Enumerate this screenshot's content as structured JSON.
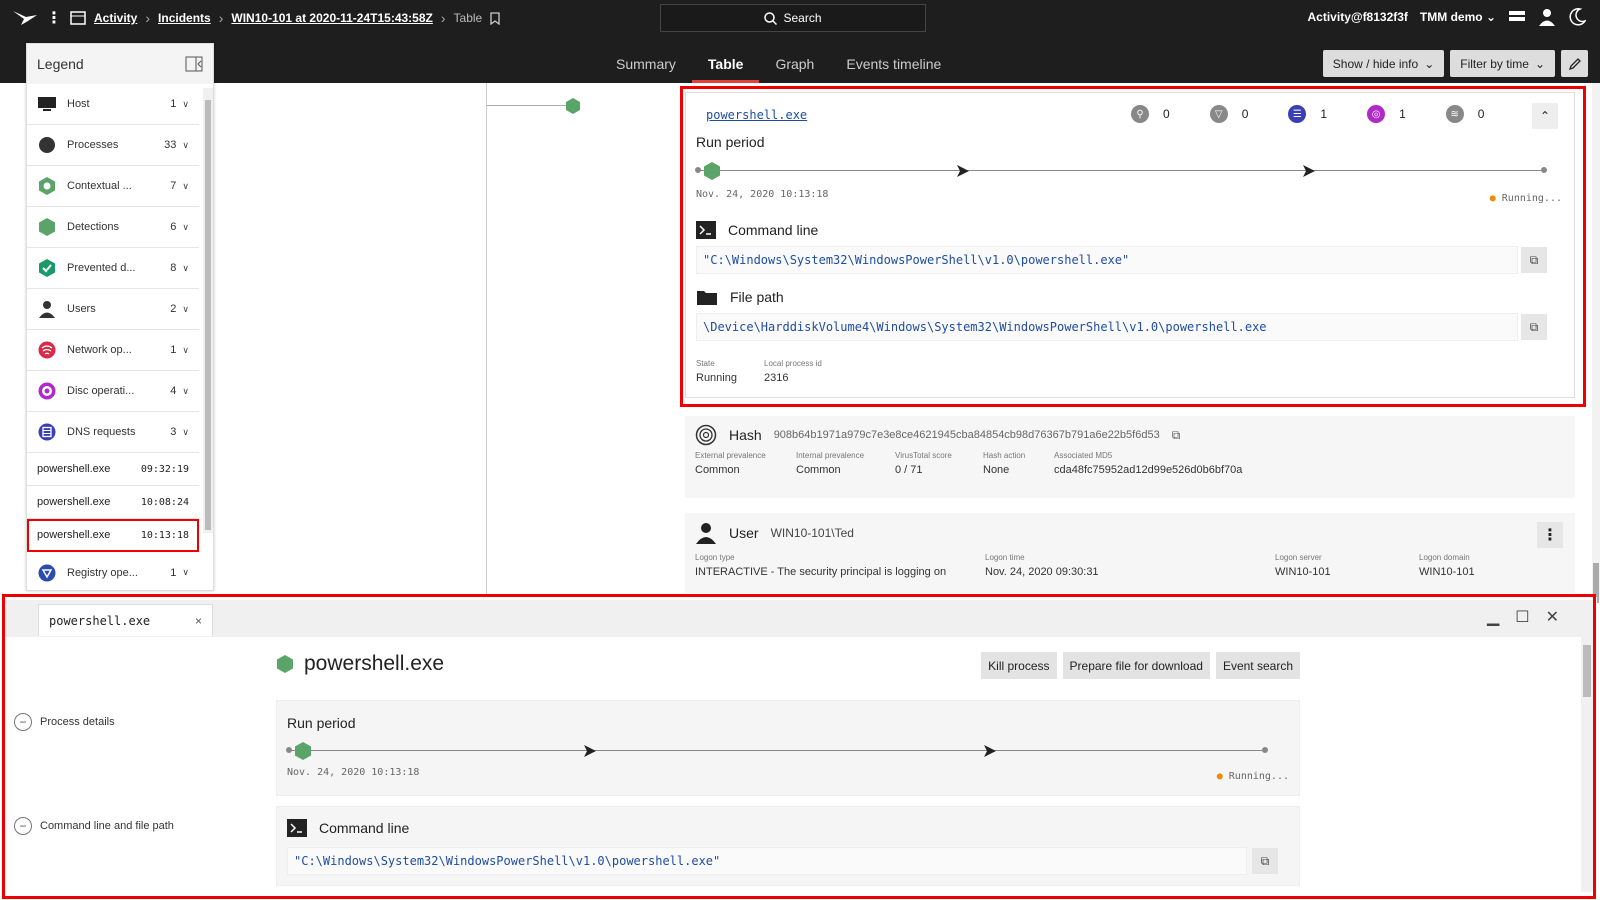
{
  "breadcrumb": {
    "items": [
      "Activity",
      "Incidents",
      "WIN10-101 at 2020-11-24T15:43:58Z"
    ],
    "current": "Table"
  },
  "search": {
    "label": "Search"
  },
  "account": {
    "user": "Activity@f8132f3f",
    "tenant": "TMM demo"
  },
  "tabs": [
    "Summary",
    "Table",
    "Graph",
    "Events timeline"
  ],
  "active_tab": "Table",
  "toolbar": {
    "show_hide_info": "Show / hide info",
    "filter_by_time": "Filter by time"
  },
  "legend": {
    "title": "Legend",
    "rows": [
      {
        "label": "Host",
        "count": "1",
        "icon": "monitor-icon"
      },
      {
        "label": "Processes",
        "count": "33",
        "icon": "process-dot-icon"
      },
      {
        "label": "Contextual ...",
        "count": "7",
        "icon": "contextual-hex-icon"
      },
      {
        "label": "Detections",
        "count": "6",
        "icon": "detection-hex-icon"
      },
      {
        "label": "Prevented d...",
        "count": "8",
        "icon": "shield-check-icon"
      },
      {
        "label": "Users",
        "count": "2",
        "icon": "user-icon"
      },
      {
        "label": "Network op...",
        "count": "1",
        "icon": "network-icon"
      },
      {
        "label": "Disc operati...",
        "count": "4",
        "icon": "disc-icon"
      },
      {
        "label": "DNS requests",
        "count": "3",
        "icon": "dns-icon"
      }
    ],
    "processes": [
      {
        "name": "powershell.exe",
        "time": "09:32:19"
      },
      {
        "name": "powershell.exe",
        "time": "10:08:24"
      },
      {
        "name": "powershell.exe",
        "time": "10:13:18"
      }
    ],
    "registry": {
      "label": "Registry ope...",
      "count": "1"
    }
  },
  "card": {
    "process_name": "powershell.exe",
    "icon_counts": [
      "0",
      "0",
      "1",
      "1",
      "0"
    ],
    "run_period_label": "Run period",
    "start_time": "Nov. 24, 2020 10:13:18",
    "running_label": "Running...",
    "command_line_label": "Command line",
    "command_line": "\"C:\\Windows\\System32\\WindowsPowerShell\\v1.0\\powershell.exe\"",
    "file_path_label": "File path",
    "file_path": "\\Device\\HarddiskVolume4\\Windows\\System32\\WindowsPowerShell\\v1.0\\powershell.exe",
    "state_label": "State",
    "state": "Running",
    "pid_label": "Local process id",
    "pid": "2316"
  },
  "hash": {
    "label": "Hash",
    "value": "908b64b1971a979c7e3e8ce4621945cba84854cb98d76367b791a6e22b5f6d53",
    "fields": [
      {
        "label": "External prevalence",
        "value": "Common"
      },
      {
        "label": "Internal prevalence",
        "value": "Common"
      },
      {
        "label": "VirusTotal score",
        "value": "0 / 71"
      },
      {
        "label": "Hash action",
        "value": "None"
      },
      {
        "label": "Associated MD5",
        "value": "cda48fc75952ad12d99e526d0b6bf70a"
      }
    ]
  },
  "user": {
    "label": "User",
    "value": "WIN10-101\\Ted",
    "fields": [
      {
        "label": "Logon type",
        "value": "INTERACTIVE - The security principal is logging on"
      },
      {
        "label": "Logon time",
        "value": "Nov. 24, 2020 09:30:31"
      },
      {
        "label": "Logon server",
        "value": "WIN10-101"
      },
      {
        "label": "Logon domain",
        "value": "WIN10-101"
      }
    ]
  },
  "panel": {
    "tab": "powershell.exe",
    "title": "powershell.exe",
    "buttons": [
      "Kill process",
      "Prepare file for download",
      "Event search"
    ],
    "side": [
      "Process details",
      "Command line and file path"
    ],
    "run_period_label": "Run period",
    "start_time": "Nov. 24, 2020 10:13:18",
    "running_label": "Running...",
    "command_line_label": "Command line",
    "command_line": "\"C:\\Windows\\System32\\WindowsPowerShell\\v1.0\\powershell.exe\""
  },
  "colors": {
    "accent_red": "#e0403e",
    "hex_green": "#5aa469",
    "highlight": "#ee0000"
  }
}
